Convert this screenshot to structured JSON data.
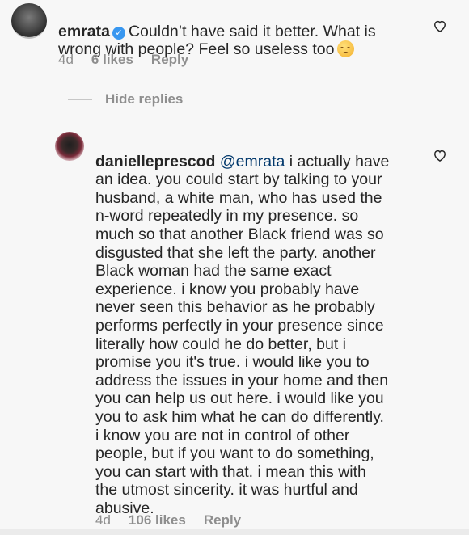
{
  "comment1": {
    "username": "emrata",
    "text_line1": "Couldn’t have said it better. What is",
    "text_line2": "wrong with people? Feel so useless too",
    "emoji": "pensive-face-emoji",
    "time": "4d",
    "likes": "6 likes",
    "reply_label": "Reply"
  },
  "hide_replies_label": "Hide replies",
  "comment2": {
    "username": "danielleprescod",
    "mention": "@emrata",
    "text_first": " i actually have",
    "text_rest": "an idea. you could start by talking to your\nhusband, a white man, who has used the\nn-word repeatedly in my presence. so\nmuch so that another Black friend was so\ndisgusted that she left the party. another\nBlack woman had the same exact\nexperience. i know you probably have\nnever seen this behavior as he probably\nperforms perfectly in your presence since\nliterally how could he do better, but i\npromise you it's true. i would like you to\naddress the issues in your home and then\nyou can help us out here. i would like you\nyou to ask him what he can do differently.\ni know you are not in control of other\npeople, but if you want to do something,\nyou can start with that. i mean this with\nthe utmost sincerity. it was hurtful and\nabusive.",
    "time": "4d",
    "likes": "106 likes",
    "reply_label": "Reply"
  },
  "colors": {
    "background": "#f7f7f7",
    "text": "#262626",
    "muted": "#8e8e8e",
    "mention": "#00376b",
    "verified": "#3897f0"
  }
}
